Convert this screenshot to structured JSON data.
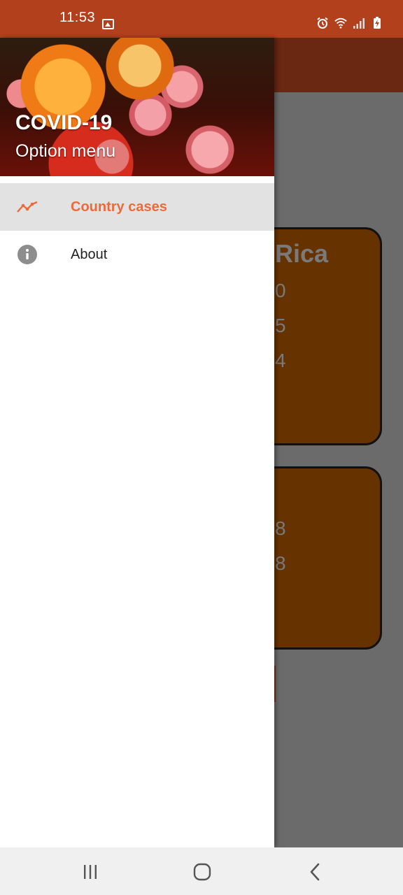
{
  "status_bar": {
    "time": "11:53",
    "icons": [
      "gallery-icon",
      "alarm-icon",
      "wifi-icon",
      "signal-icon",
      "battery-charging-icon"
    ]
  },
  "drawer": {
    "header": {
      "title": "COVID-19",
      "subtitle": "Option menu"
    },
    "items": [
      {
        "label": "Country cases",
        "icon": "trending-up-icon",
        "selected": true
      },
      {
        "label": "About",
        "icon": "info-icon",
        "selected": false
      }
    ]
  },
  "background_app": {
    "card1": {
      "title_fragment": "Rica",
      "values": [
        "0",
        "5",
        "4"
      ]
    },
    "card2": {
      "values": [
        "8",
        "8"
      ]
    }
  },
  "colors": {
    "status_bar": "#b3401c",
    "accent": "#ec6a3a",
    "card": "#663300",
    "selected_bg": "#e2e2e2"
  },
  "nav": {
    "buttons": [
      "recent-apps-icon",
      "home-icon",
      "back-icon"
    ]
  }
}
